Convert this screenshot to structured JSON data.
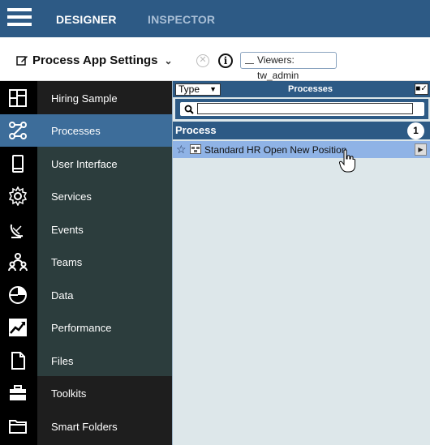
{
  "topbar": {
    "tabs": [
      {
        "label": "DESIGNER",
        "active": true
      },
      {
        "label": "INSPECTOR",
        "active": false
      }
    ]
  },
  "header": {
    "title": "Process App Settings",
    "viewers_label": "Viewers: tw_admin"
  },
  "sidebar": {
    "items": [
      {
        "label": "Hiring Sample",
        "icon": "dashboard-icon"
      },
      {
        "label": "Processes",
        "icon": "process-flow-icon",
        "active": true
      },
      {
        "label": "User Interface",
        "icon": "mobile-device-icon"
      },
      {
        "label": "Services",
        "icon": "gear-icon"
      },
      {
        "label": "Events",
        "icon": "satellite-dish-icon"
      },
      {
        "label": "Teams",
        "icon": "team-icon"
      },
      {
        "label": "Data",
        "icon": "pie-chart-icon"
      },
      {
        "label": "Performance",
        "icon": "trend-chart-icon"
      },
      {
        "label": "Files",
        "icon": "file-icon"
      },
      {
        "label": "Toolkits",
        "icon": "toolbox-icon"
      },
      {
        "label": "Smart Folders",
        "icon": "folder-icon"
      }
    ]
  },
  "content": {
    "type_filter": "Type",
    "column_title": "Processes",
    "search_value": "",
    "group": {
      "label": "Process",
      "count": "1"
    },
    "items": [
      {
        "name": "Standard HR Open New Position"
      }
    ]
  },
  "colors": {
    "brand": "#2d5a85",
    "active_nav": "#3d6d9a",
    "selected_row": "#8fb3e6"
  }
}
